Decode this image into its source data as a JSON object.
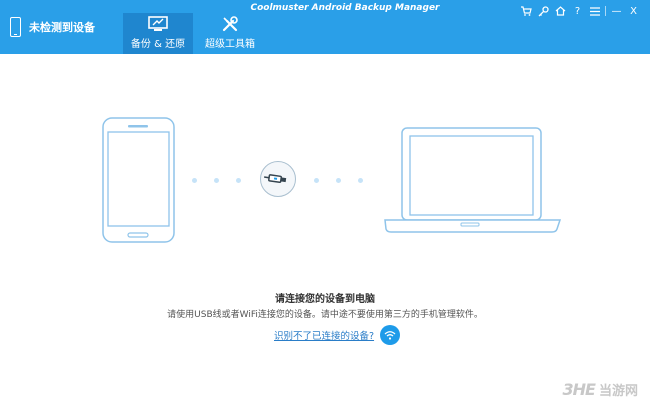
{
  "header": {
    "device_status": "未检测到设备",
    "app_title": "Coolmuster Android Backup Manager"
  },
  "tabs": [
    {
      "label": "备份 & 还原",
      "active": true,
      "icon": "backup-restore-icon"
    },
    {
      "label": "超级工具箱",
      "active": false,
      "icon": "tools-icon"
    }
  ],
  "window_controls": [
    "cart-icon",
    "key-icon",
    "home-icon",
    "help-icon",
    "menu-icon",
    "minimize-icon",
    "close-icon"
  ],
  "window_control_glyphs": {
    "minimize": "—",
    "close": "X",
    "help": "?"
  },
  "main": {
    "title": "请连接您的设备到电脑",
    "subtitle": "请使用USB线或者WiFi连接您的设备。请中途不要使用第三方的手机管理软件。",
    "help_link": "识别不了已连接的设备?"
  },
  "watermark": {
    "logo": "3HE",
    "text": "当游网"
  },
  "colors": {
    "header_bg": "#2a9fe8",
    "active_tab_bg": "#1f86cf",
    "illustration_stroke": "#8fc4ea",
    "wifi_button": "#1e9be9"
  }
}
